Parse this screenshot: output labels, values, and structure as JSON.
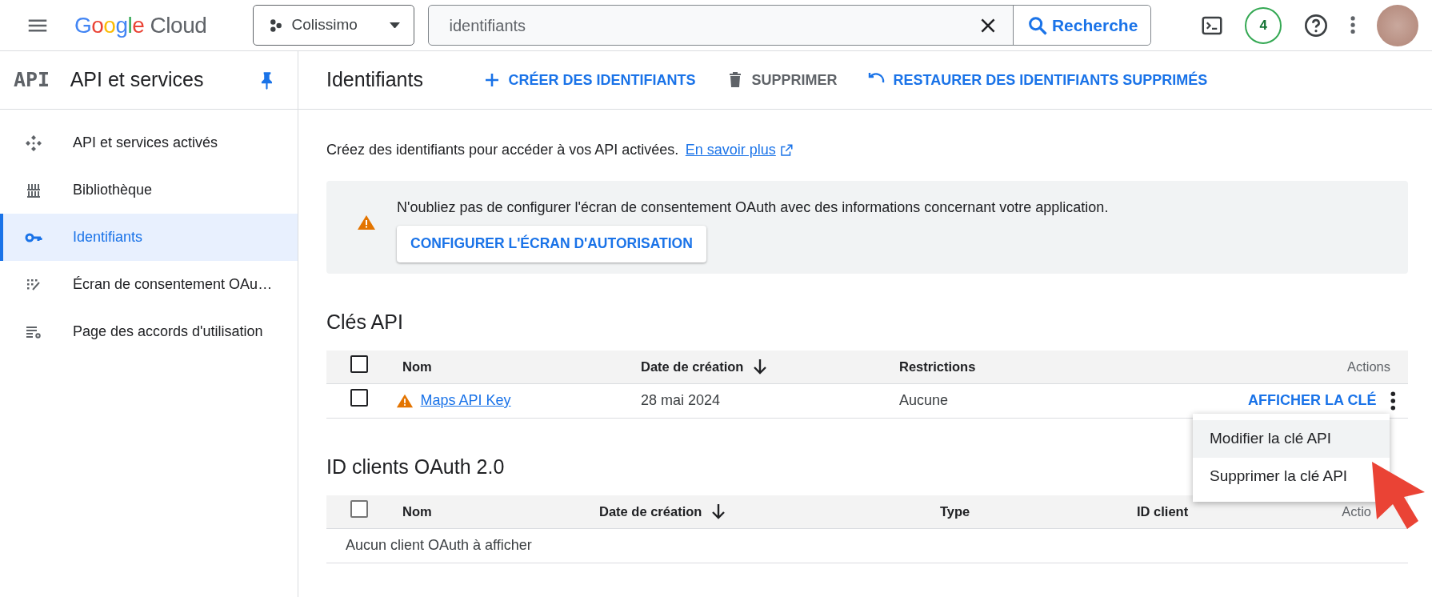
{
  "topbar": {
    "logo": "Google Cloud",
    "project": "Colissimo",
    "search": {
      "value": "identifiants"
    },
    "search_button": "Recherche",
    "notifications": "4"
  },
  "sidebar": {
    "badge": "API",
    "title": "API et services",
    "items": [
      {
        "label": "API et services activés",
        "selected": false
      },
      {
        "label": "Bibliothèque",
        "selected": false
      },
      {
        "label": "Identifiants",
        "selected": true
      },
      {
        "label": "Écran de consentement OAu…",
        "selected": false
      },
      {
        "label": "Page des accords d'utilisation",
        "selected": false
      }
    ]
  },
  "header": {
    "title": "Identifiants",
    "actions": [
      {
        "label": "CRÉER DES IDENTIFIANTS",
        "kind": "add",
        "disabled": false
      },
      {
        "label": "SUPPRIMER",
        "kind": "delete",
        "disabled": true
      },
      {
        "label": "RESTAURER DES IDENTIFIANTS SUPPRIMÉS",
        "kind": "restore",
        "disabled": false
      }
    ]
  },
  "intro": {
    "text": "Créez des identifiants pour accéder à vos API activées.",
    "link": "En savoir plus"
  },
  "alert": {
    "text": "N'oubliez pas de configurer l'écran de consentement OAuth avec des informations concernant votre application.",
    "button": "CONFIGURER L'ÉCRAN D'AUTORISATION"
  },
  "api_keys": {
    "title": "Clés API",
    "select_all": {
      "checked": false,
      "disabled": false
    },
    "columns": [
      {
        "label": "Nom",
        "sorted": false
      },
      {
        "label": "Date de création",
        "sorted": true
      },
      {
        "label": "Restrictions",
        "sorted": false
      },
      {
        "label": "Actions",
        "sorted": false
      }
    ],
    "rows": [
      {
        "checked": false,
        "warning": true,
        "name": "Maps API Key",
        "date": "28 mai 2024",
        "restrictions": "Aucune",
        "action": "AFFICHER LA CLÉ"
      }
    ]
  },
  "oauth_clients": {
    "title": "ID clients OAuth 2.0",
    "select_all": {
      "checked": false,
      "disabled": true
    },
    "columns": [
      {
        "label": "Nom",
        "sorted": false
      },
      {
        "label": "Date de création",
        "sorted": true
      },
      {
        "label": "Type",
        "sorted": false
      },
      {
        "label": "ID client",
        "sorted": false
      },
      {
        "label": "Actio",
        "sorted": false
      }
    ],
    "empty": "Aucun client OAuth à afficher"
  },
  "menu": {
    "items": [
      {
        "label": "Modifier la clé API",
        "selected": true
      },
      {
        "label": "Supprimer la clé API",
        "selected": false
      }
    ]
  }
}
